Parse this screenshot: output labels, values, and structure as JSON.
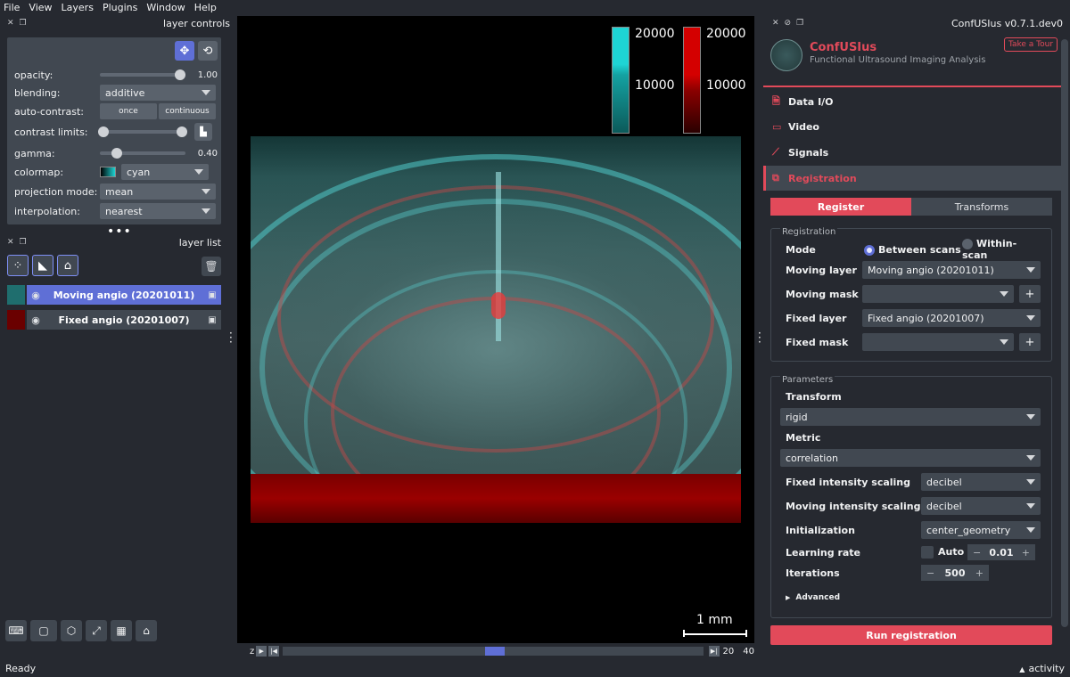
{
  "menu": [
    "File",
    "View",
    "Layers",
    "Plugins",
    "Window",
    "Help"
  ],
  "layer_controls": {
    "title": "layer controls",
    "opacity": {
      "label": "opacity:",
      "value": "1.00",
      "fraction": 1.0
    },
    "blending": {
      "label": "blending:",
      "value": "additive"
    },
    "auto_contrast": {
      "label": "auto-contrast:",
      "once": "once",
      "continuous": "continuous"
    },
    "contrast_limits": {
      "label": "contrast limits:"
    },
    "gamma": {
      "label": "gamma:",
      "value": "0.40",
      "fraction": 0.15
    },
    "colormap": {
      "label": "colormap:",
      "value": "cyan"
    },
    "projection_mode": {
      "label": "projection mode:",
      "value": "mean"
    },
    "interpolation": {
      "label": "interpolation:",
      "value": "nearest"
    }
  },
  "layer_list": {
    "title": "layer list",
    "layers": [
      {
        "name": "Moving angio (20201011)",
        "selected": true,
        "thumb_color": "#1f6e6e"
      },
      {
        "name": "Fixed angio (20201007)",
        "selected": false,
        "thumb_color": "#6a0000"
      }
    ]
  },
  "canvas": {
    "colorbars": [
      {
        "color": "#1ed4d4",
        "max_label": "20000",
        "mid_label": "10000"
      },
      {
        "color": "#d40000",
        "max_label": "20000",
        "mid_label": "10000"
      }
    ],
    "scale_label": "1 mm"
  },
  "dims": {
    "axis": "z",
    "value": "20",
    "max": "40",
    "fraction": 0.5
  },
  "plugin": {
    "window_title": "ConfUSIus v0.7.1.dev0",
    "brand_name": "ConfUSIus",
    "brand_sub": "Functional Ultrasound Imaging Analysis",
    "tour_label": "Take a Tour",
    "nav": [
      {
        "label": "Data I/O",
        "icon": "file-icon",
        "glyph": "🗎",
        "active": false
      },
      {
        "label": "Video",
        "icon": "video-icon",
        "glyph": "▭",
        "active": false
      },
      {
        "label": "Signals",
        "icon": "chart-icon",
        "glyph": "⟋",
        "active": false
      },
      {
        "label": "Registration",
        "icon": "registration-icon",
        "glyph": "⧉",
        "active": true
      }
    ],
    "subtabs": [
      "Register",
      "Transforms"
    ],
    "registration_group": {
      "title": "Registration",
      "mode_label": "Mode",
      "mode_options": [
        "Between scans",
        "Within-scan"
      ],
      "moving_layer_label": "Moving layer",
      "moving_layer_value": "Moving angio (20201011)",
      "moving_mask_label": "Moving mask",
      "moving_mask_value": "",
      "fixed_layer_label": "Fixed layer",
      "fixed_layer_value": "Fixed angio (20201007)",
      "fixed_mask_label": "Fixed mask",
      "fixed_mask_value": ""
    },
    "parameters_group": {
      "title": "Parameters",
      "transform_label": "Transform",
      "transform_value": "rigid",
      "metric_label": "Metric",
      "metric_value": "correlation",
      "fixed_scaling_label": "Fixed intensity scaling",
      "fixed_scaling_value": "decibel",
      "moving_scaling_label": "Moving intensity scaling",
      "moving_scaling_value": "decibel",
      "initialization_label": "Initialization",
      "initialization_value": "center_geometry",
      "learning_rate_label": "Learning rate",
      "auto_label": "Auto",
      "learning_rate_value": "0.01",
      "iterations_label": "Iterations",
      "iterations_value": "500",
      "advanced_label": "Advanced"
    },
    "run_label": "Run registration"
  },
  "status": {
    "left": "Ready",
    "right": "activity"
  }
}
